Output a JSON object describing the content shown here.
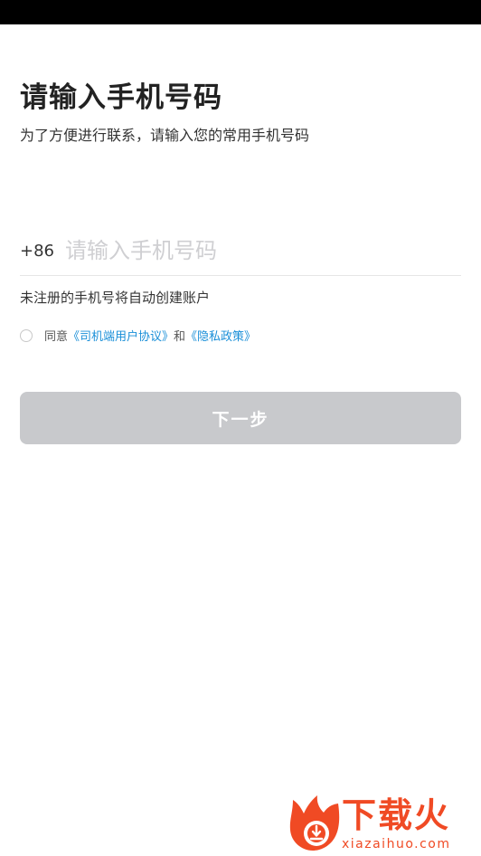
{
  "header": {
    "title": "请输入手机号码",
    "subtitle": "为了方便进行联系，请输入您的常用手机号码"
  },
  "phone": {
    "country_code": "+86",
    "placeholder": "请输入手机号码",
    "value": ""
  },
  "notice": "未注册的手机号将自动创建账户",
  "agreement": {
    "checked": false,
    "prefix": "同意",
    "link1": "《司机端用户协议》",
    "conjunction": "和",
    "link2": "《隐私政策》"
  },
  "next_button": {
    "label": "下一步",
    "enabled": false
  },
  "watermark": {
    "cn_text": "下载火",
    "en_text": "xiazaihuo.com",
    "color": "#f04a24",
    "icon": "fire-download-logo-icon"
  },
  "colors": {
    "link": "#1a8fd8",
    "button_disabled": "#c8c9cc",
    "placeholder": "#cfcfd2"
  }
}
